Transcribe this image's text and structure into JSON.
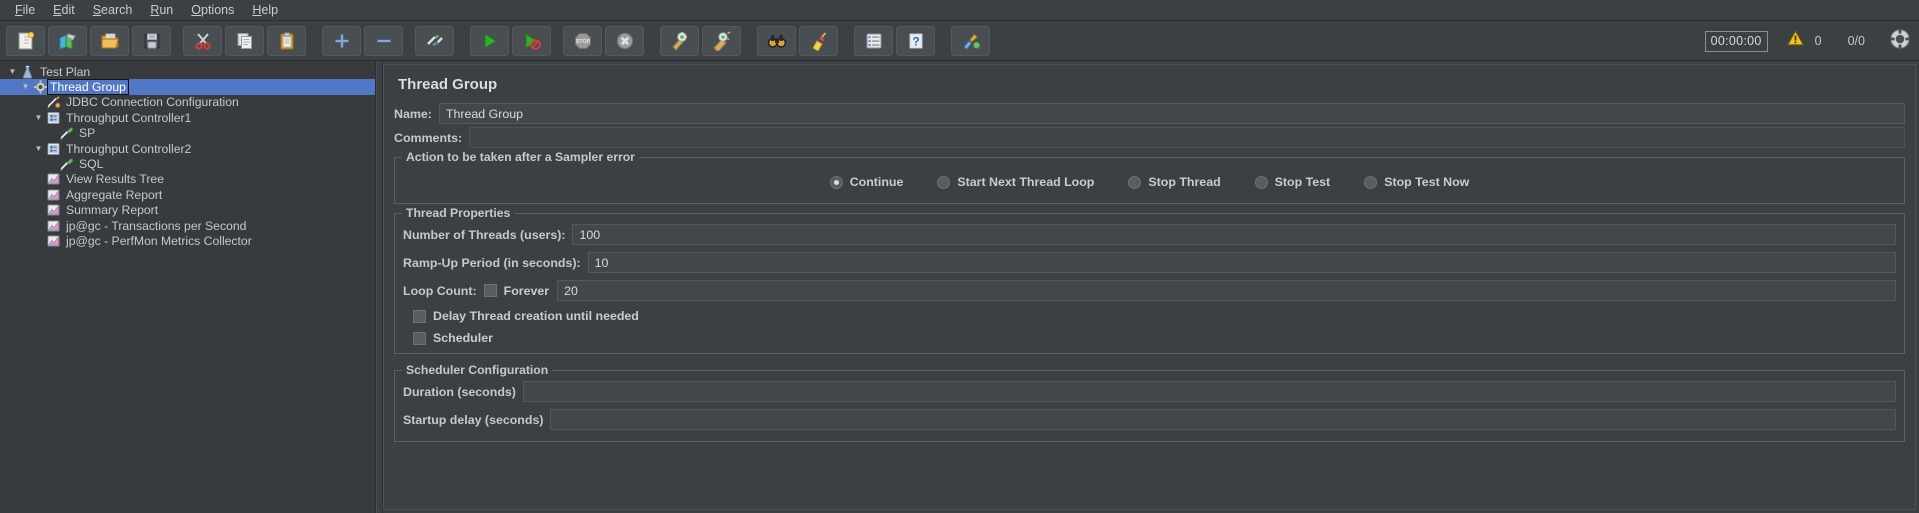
{
  "menu": {
    "items": [
      {
        "label": "File",
        "mnemonic": "F"
      },
      {
        "label": "Edit",
        "mnemonic": "E"
      },
      {
        "label": "Search",
        "mnemonic": "S"
      },
      {
        "label": "Run",
        "mnemonic": "R"
      },
      {
        "label": "Options",
        "mnemonic": "O"
      },
      {
        "label": "Help",
        "mnemonic": "H"
      }
    ]
  },
  "toolbar": {
    "buttons": [
      {
        "name": "new-test-plan-button",
        "icon": "new-document-icon",
        "tooltip": "New"
      },
      {
        "name": "templates-button",
        "icon": "templates-icon",
        "tooltip": "Templates"
      },
      {
        "name": "open-button",
        "icon": "open-folder-icon",
        "tooltip": "Open"
      },
      {
        "name": "save-button",
        "icon": "save-floppy-icon",
        "tooltip": "Save Test Plan"
      },
      {
        "name": "cut-button",
        "icon": "scissors-icon",
        "tooltip": "Cut"
      },
      {
        "name": "copy-button",
        "icon": "copy-icon",
        "tooltip": "Copy"
      },
      {
        "name": "paste-button",
        "icon": "clipboard-paste-icon",
        "tooltip": "Paste"
      },
      {
        "name": "expand-all-button",
        "icon": "plus-icon",
        "tooltip": "Expand All"
      },
      {
        "name": "collapse-all-button",
        "icon": "minus-icon",
        "tooltip": "Collapse All"
      },
      {
        "name": "toggle-button",
        "icon": "toggle-pencil-icon",
        "tooltip": "Toggle"
      },
      {
        "name": "start-button",
        "icon": "play-green-icon",
        "tooltip": "Start"
      },
      {
        "name": "start-no-pauses-button",
        "icon": "play-no-pauses-icon",
        "tooltip": "Start no pauses"
      },
      {
        "name": "stop-button",
        "icon": "stop-sign-icon",
        "tooltip": "Stop"
      },
      {
        "name": "shutdown-button",
        "icon": "shutdown-x-icon",
        "tooltip": "Shutdown"
      },
      {
        "name": "clear-button",
        "icon": "gear-broom-icon",
        "tooltip": "Clear"
      },
      {
        "name": "clear-all-button",
        "icon": "gear-broom-all-icon",
        "tooltip": "Clear All"
      },
      {
        "name": "search-button",
        "icon": "binoculars-icon",
        "tooltip": "Search"
      },
      {
        "name": "reset-search-button",
        "icon": "broom-icon",
        "tooltip": "Reset Search"
      },
      {
        "name": "function-helper-button",
        "icon": "function-list-icon",
        "tooltip": "Function Helper Dialog"
      },
      {
        "name": "help-button",
        "icon": "help-question-icon",
        "tooltip": "Help"
      },
      {
        "name": "undo-redo-button",
        "icon": "paint-tools-icon",
        "tooltip": "Undo"
      }
    ],
    "timer": "00:00:00",
    "warning_count": "0",
    "thread_count": "0/0"
  },
  "tree": {
    "nodes": [
      {
        "label": "Test Plan",
        "indent": 0,
        "twisty": "down",
        "icon": "test-plan-icon",
        "selected": false
      },
      {
        "label": "Thread Group",
        "indent": 1,
        "twisty": "down",
        "icon": "thread-group-gear-icon",
        "selected": true
      },
      {
        "label": "JDBC Connection Configuration",
        "indent": 2,
        "twisty": "none",
        "icon": "config-element-icon",
        "selected": false
      },
      {
        "label": "Throughput Controller1",
        "indent": 2,
        "twisty": "down",
        "icon": "controller-icon",
        "selected": false
      },
      {
        "label": "SP",
        "indent": 3,
        "twisty": "none",
        "icon": "sampler-pipette-icon",
        "selected": false
      },
      {
        "label": "Throughput Controller2",
        "indent": 2,
        "twisty": "down",
        "icon": "controller-icon",
        "selected": false
      },
      {
        "label": "SQL",
        "indent": 3,
        "twisty": "none",
        "icon": "sampler-pipette-icon",
        "selected": false
      },
      {
        "label": "View Results Tree",
        "indent": 2,
        "twisty": "none",
        "icon": "listener-chart-icon",
        "selected": false
      },
      {
        "label": "Aggregate Report",
        "indent": 2,
        "twisty": "none",
        "icon": "listener-chart-icon",
        "selected": false
      },
      {
        "label": "Summary Report",
        "indent": 2,
        "twisty": "none",
        "icon": "listener-chart-icon",
        "selected": false
      },
      {
        "label": "jp@gc - Transactions per Second",
        "indent": 2,
        "twisty": "none",
        "icon": "listener-chart-icon",
        "selected": false
      },
      {
        "label": "jp@gc - PerfMon Metrics Collector",
        "indent": 2,
        "twisty": "none",
        "icon": "listener-chart-icon",
        "selected": false
      }
    ]
  },
  "panel": {
    "title": "Thread Group",
    "name_label": "Name:",
    "name_value": "Thread Group",
    "comments_label": "Comments:",
    "comments_value": "",
    "sampler_error": {
      "title": "Action to be taken after a Sampler error",
      "options": [
        {
          "label": "Continue",
          "selected": true
        },
        {
          "label": "Start Next Thread Loop",
          "selected": false
        },
        {
          "label": "Stop Thread",
          "selected": false
        },
        {
          "label": "Stop Test",
          "selected": false
        },
        {
          "label": "Stop Test Now",
          "selected": false
        }
      ]
    },
    "thread_properties": {
      "title": "Thread Properties",
      "num_threads_label": "Number of Threads (users):",
      "num_threads_value": "100",
      "ramp_up_label": "Ramp-Up Period (in seconds):",
      "ramp_up_value": "10",
      "loop_count_label": "Loop Count:",
      "forever_label": "Forever",
      "forever_checked": false,
      "loop_count_value": "20",
      "delay_thread_label": "Delay Thread creation until needed",
      "delay_thread_checked": false,
      "scheduler_label": "Scheduler",
      "scheduler_checked": false
    },
    "scheduler_configuration": {
      "title": "Scheduler Configuration",
      "duration_label": "Duration (seconds)",
      "duration_value": "",
      "startup_delay_label": "Startup delay (seconds)",
      "startup_delay_value": ""
    }
  },
  "colors": {
    "background": "#3c4043",
    "panel": "#383b3e",
    "selection": "#5277c5",
    "text": "#c5c9cc",
    "accent_green": "#49b749",
    "warning_yellow": "#f2c21d"
  }
}
